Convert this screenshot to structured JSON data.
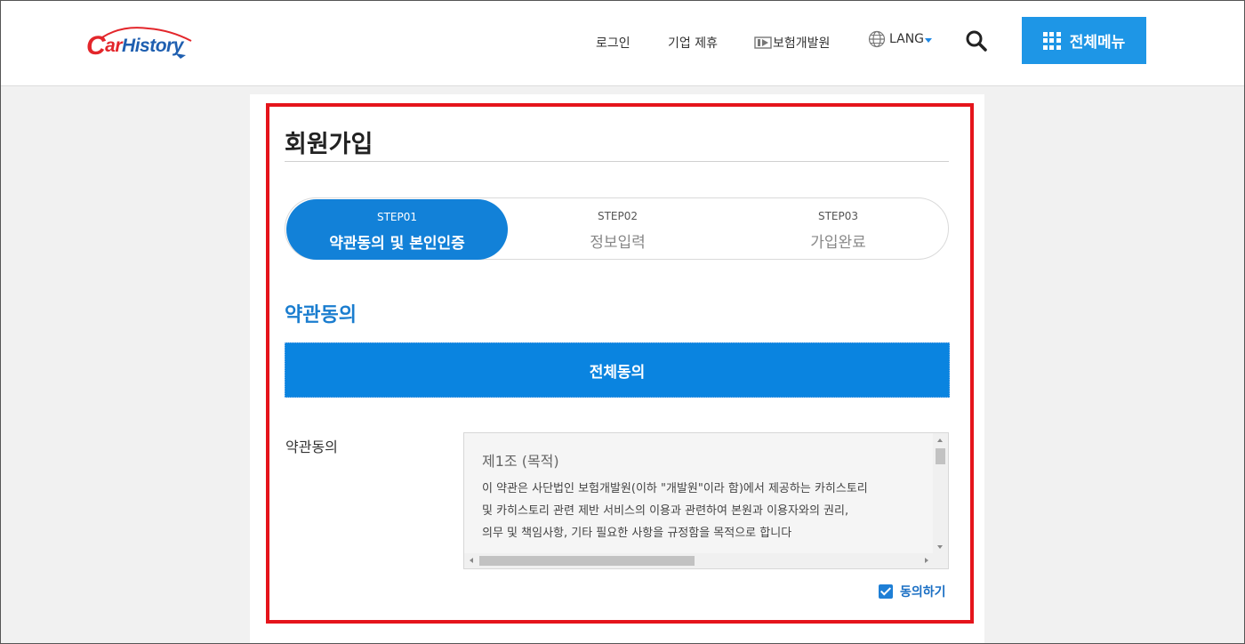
{
  "header": {
    "logo_text": "CarHistory",
    "nav": {
      "login": "로그인",
      "partnership": "기업 제휴",
      "kidi": "보험개발원",
      "lang": "LANG"
    },
    "menu_button": "전체메뉴"
  },
  "page": {
    "title": "회원가입",
    "steps": [
      {
        "num": "STEP01",
        "label": "약관동의 및 본인인증",
        "active": true
      },
      {
        "num": "STEP02",
        "label": "정보입력",
        "active": false
      },
      {
        "num": "STEP03",
        "label": "가입완료",
        "active": false
      }
    ],
    "section_title": "약관동의",
    "agree_all_button": "전체동의",
    "terms": {
      "label": "약관동의",
      "heading": "제1조 (목적)",
      "body_lines": [
        "이 약관은 사단법인 보험개발원(이하 \"개발원\"이라 함)에서 제공하는 카히스토리",
        "및 카히스토리 관련 제반 서비스의 이용과 관련하여 본원과 이용자와의 권리,",
        "의무 및 책임사항, 기타 필요한 사항을 규정함을 목적으로 합니다"
      ]
    },
    "agree_checkbox": {
      "label": "동의하기",
      "checked": true
    }
  },
  "colors": {
    "primary": "#1281d8",
    "highlight_border": "#e5141b",
    "logo_red": "#e3262b",
    "logo_blue": "#1f5fb0"
  },
  "icons": [
    "search-icon",
    "grid-menu-icon",
    "globe-icon",
    "kidi-logo-icon",
    "checkbox-checked-icon"
  ]
}
